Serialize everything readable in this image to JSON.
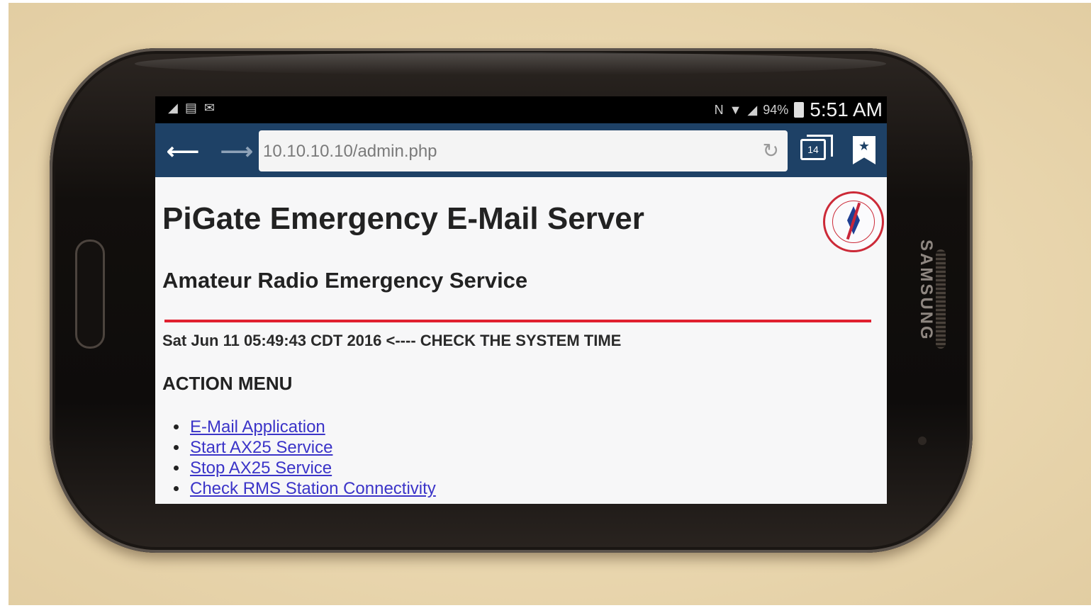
{
  "status_bar": {
    "time": "5:51 AM",
    "battery_percent": "94%",
    "left_icons": [
      "signal-icon",
      "message-icon",
      "mail-icon"
    ],
    "right_icons": [
      "nfc-icon",
      "wifi-icon",
      "cell-signal-icon",
      "battery-icon"
    ]
  },
  "browser": {
    "url": "10.10.10.10/admin.php",
    "tab_count": "14",
    "toolbar_color": "#1e4166"
  },
  "page": {
    "title": "PiGate Emergency E-Mail Server",
    "subtitle": "Amateur Radio Emergency Service",
    "system_time": "Sat Jun 11 05:49:43 CDT 2016 <---- CHECK THE SYSTEM TIME",
    "menu_heading": "ACTION MENU",
    "menu_items": [
      {
        "label": "E-Mail Application"
      },
      {
        "label": "Start AX25 Service"
      },
      {
        "label": "Stop AX25 Service"
      },
      {
        "label": "Check RMS Station Connectivity"
      }
    ],
    "divider_color": "#e0202f",
    "link_color": "#3b34c8"
  },
  "device": {
    "brand": "SAMSUNG"
  }
}
